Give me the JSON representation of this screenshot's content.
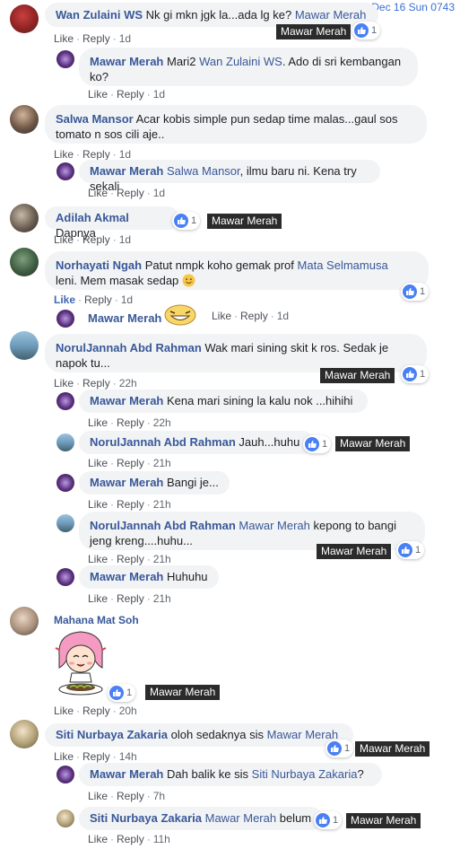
{
  "timestamp": "Dec 16 Sun 0743",
  "tagger_name": "Mawar Merah",
  "actions": {
    "like": "Like",
    "reply": "Reply",
    "sep": "·"
  },
  "comments": [
    {
      "author": "Wan Zulaini WS",
      "text": "Nk gi mkn jgk la...ada lg ke?",
      "mention": "Mawar Merah",
      "likes": "1",
      "time": "1d",
      "replies": [
        {
          "author": "Mawar Merah",
          "mention": "Wan Zulaini WS",
          "text_after": ". Ado di sri kembangan ko?",
          "time": "1d"
        }
      ]
    },
    {
      "author": "Salwa Mansor",
      "text": "Acar kobis simple pun sedap time malas...gaul sos tomato n sos cili aje..",
      "time": "1d",
      "replies": [
        {
          "author": "Mawar Merah",
          "mention": "Salwa Mansor",
          "text_after": ", ilmu baru ni. Kena try sekali",
          "time": "1d"
        }
      ]
    },
    {
      "author": "Adilah Akmal",
      "text": "Dapnya",
      "likes": "1",
      "time": "1d"
    },
    {
      "author": "Norhayati Ngah",
      "text": "Patut nmpk koho gemak prof",
      "mention": "Mata Selmamusa",
      "text_after": "leni. Mem masak sedap",
      "likes": "1",
      "time": "1d",
      "reply_sticker": {
        "author": "Mawar Merah",
        "time": "1d"
      }
    },
    {
      "author": "NorulJannah Abd Rahman",
      "text": "Wak mari sining skit k ros. Sedak je napok tu...",
      "likes": "1",
      "time": "22h",
      "replies": [
        {
          "author": "Mawar Merah",
          "text": "Kena mari sining la kalu nok ...hihihi",
          "time": "22h"
        },
        {
          "author": "NorulJannah Abd Rahman",
          "text": "Jauh...huhu",
          "likes": "1",
          "time": "21h"
        },
        {
          "author": "Mawar Merah",
          "text": "Bangi je...",
          "time": "21h"
        },
        {
          "author": "NorulJannah Abd Rahman",
          "mention": "Mawar Merah",
          "text_after": "kepong to bangi jeng kreng....huhu...",
          "likes": "1",
          "time": "21h"
        },
        {
          "author": "Mawar Merah",
          "text": "Huhuhu",
          "time": "21h"
        }
      ]
    },
    {
      "author": "Mahana Mat Soh",
      "likes": "1",
      "time": "20h"
    },
    {
      "author": "Siti Nurbaya Zakaria",
      "text": "oloh sedaknya sis",
      "mention": "Mawar Merah",
      "likes": "1",
      "time": "14h",
      "replies": [
        {
          "author": "Mawar Merah",
          "text": "Dah balik ke sis",
          "mention": "Siti Nurbaya Zakaria",
          "text_after": "?",
          "time": "7h"
        },
        {
          "author": "Siti Nurbaya Zakaria",
          "mention": "Mawar Merah",
          "text_after": "belum",
          "likes": "1",
          "time": "11h"
        }
      ]
    }
  ]
}
